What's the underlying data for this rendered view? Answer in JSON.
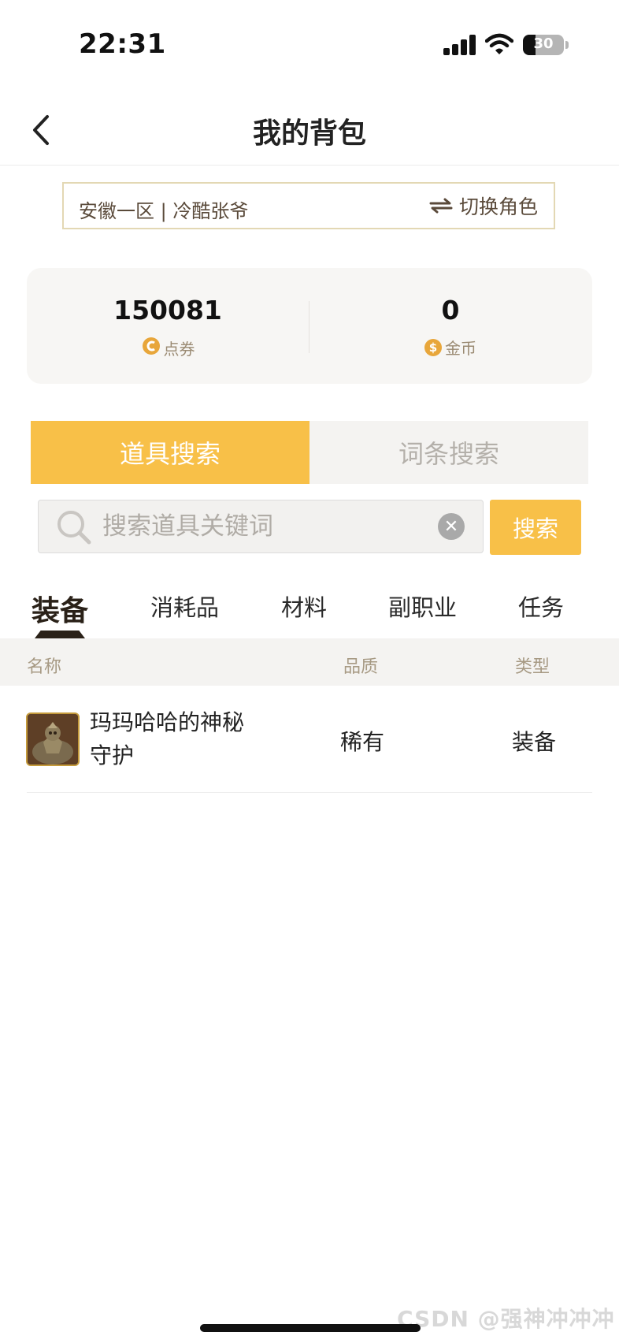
{
  "status_bar": {
    "time": "22:31",
    "battery": "30"
  },
  "nav": {
    "title": "我的背包"
  },
  "role": {
    "name": "安徽一区 | 冷酷张爷",
    "switch_label": "切换角色"
  },
  "currency": [
    {
      "value": "150081",
      "label": "点券",
      "icon": "voucher-coin-icon"
    },
    {
      "value": "0",
      "label": "金币",
      "icon": "gold-coin-icon"
    }
  ],
  "search_tabs": [
    {
      "label": "道具搜索",
      "active": true
    },
    {
      "label": "词条搜索",
      "active": false
    }
  ],
  "search": {
    "placeholder": "搜索道具关键词",
    "button_label": "搜索"
  },
  "categories": [
    {
      "label": "装备",
      "active": true
    },
    {
      "label": "消耗品"
    },
    {
      "label": "材料"
    },
    {
      "label": "副职业"
    },
    {
      "label": "任务"
    }
  ],
  "table": {
    "headers": {
      "name": "名称",
      "quality": "品质",
      "type": "类型"
    },
    "rows": [
      {
        "name": "玛玛哈哈的神秘守护",
        "quality": "稀有",
        "type": "装备",
        "icon": "mamahaha-item-icon"
      }
    ]
  },
  "watermark": "CSDN @强神冲冲冲",
  "colors": {
    "accent": "#f8c048",
    "text_brown": "#5a4a3a",
    "muted": "#a79a84"
  }
}
